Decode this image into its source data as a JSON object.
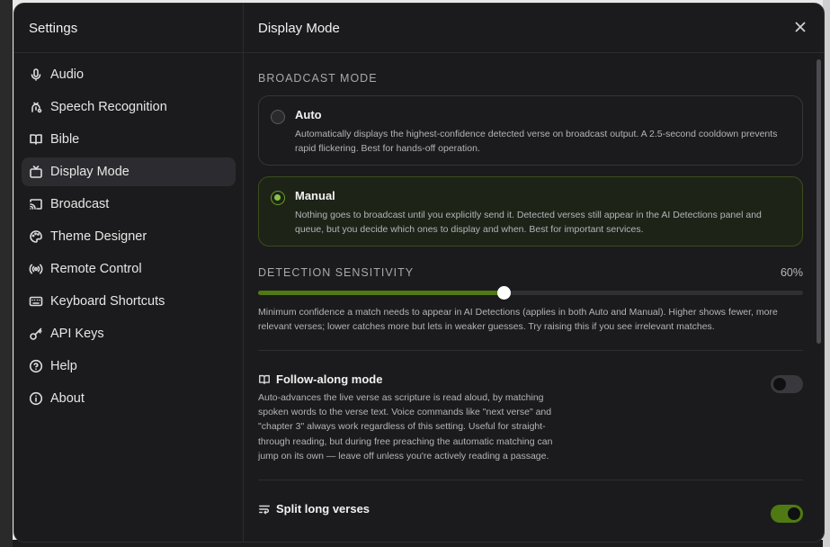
{
  "sidebar": {
    "title": "Settings",
    "items": [
      {
        "label": "Audio",
        "icon": "microphone-icon"
      },
      {
        "label": "Speech Recognition",
        "icon": "speech-recognition-icon"
      },
      {
        "label": "Bible",
        "icon": "book-open-icon"
      },
      {
        "label": "Display Mode",
        "icon": "tv-icon",
        "active": true
      },
      {
        "label": "Broadcast",
        "icon": "cast-icon"
      },
      {
        "label": "Theme Designer",
        "icon": "palette-icon"
      },
      {
        "label": "Remote Control",
        "icon": "radio-signal-icon"
      },
      {
        "label": "Keyboard Shortcuts",
        "icon": "keyboard-icon"
      },
      {
        "label": "API Keys",
        "icon": "key-icon"
      },
      {
        "label": "Help",
        "icon": "help-circle-icon"
      },
      {
        "label": "About",
        "icon": "info-icon"
      }
    ]
  },
  "main": {
    "title": "Display Mode",
    "broadcast_mode": {
      "label": "BROADCAST MODE",
      "options": [
        {
          "title": "Auto",
          "description": "Automatically displays the highest-confidence detected verse on broadcast output. A 2.5-second cooldown prevents rapid flickering. Best for hands-off operation.",
          "selected": false
        },
        {
          "title": "Manual",
          "description": "Nothing goes to broadcast until you explicitly send it. Detected verses still appear in the AI Detections panel and queue, but you decide which ones to display and when. Best for important services.",
          "selected": true
        }
      ]
    },
    "sensitivity": {
      "label": "DETECTION SENSITIVITY",
      "value_text": "60%",
      "fill_fraction": 0.45,
      "help": "Minimum confidence a match needs to appear in AI Detections (applies in both Auto and Manual). Higher shows fewer, more relevant verses; lower catches more but lets in weaker guesses. Try raising this if you see irrelevant matches."
    },
    "follow_along": {
      "title": "Follow-along mode",
      "description": "Auto-advances the live verse as scripture is read aloud, by matching spoken words to the verse text. Voice commands like \"next verse\" and \"chapter 3\" always work regardless of this setting. Useful for straight-through reading, but during free preaching the automatic matching can jump on its own — leave off unless you're actively reading a passage.",
      "enabled": false
    },
    "split_long": {
      "title": "Split long verses",
      "enabled": true
    }
  },
  "colors": {
    "accent": "#4f7a13",
    "accent_dot": "#8bc34a",
    "panel_bg": "#1b1b1d"
  }
}
